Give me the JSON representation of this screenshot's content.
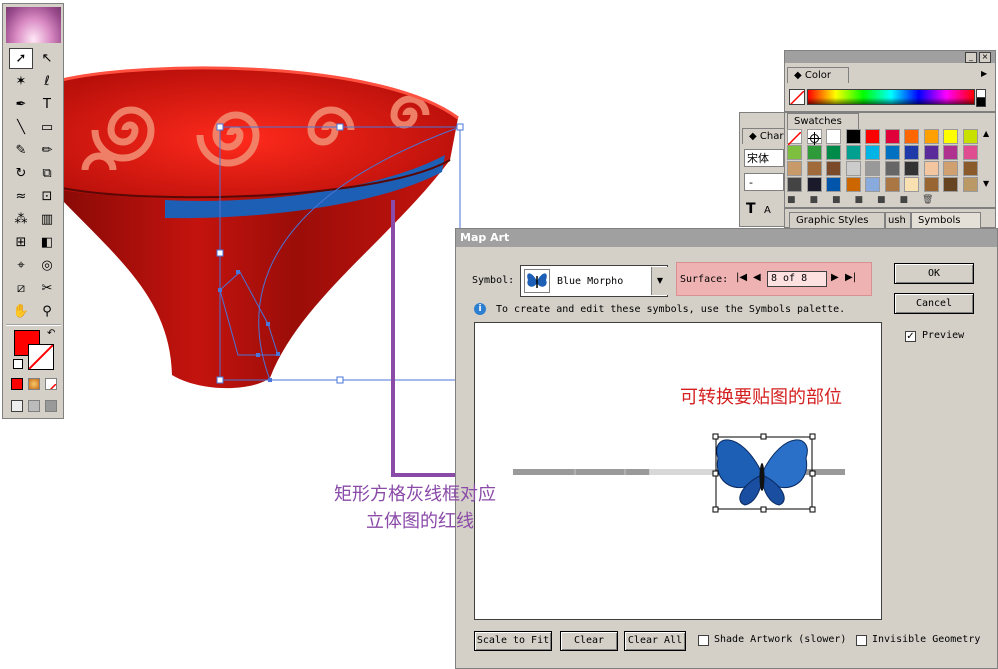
{
  "colors": {
    "vase_red": "#c4130e",
    "swirl": "#f28a70",
    "rim_blue": "#1d5fb5",
    "selection_blue": "#4a74d6",
    "annotation_purple": "#8a4aa8",
    "annotation_pink": "#f5b0b0",
    "annotation_red_text": "#d42020",
    "dialog_bg": "#d4d0c8",
    "fill_swatch": "#ff0000"
  },
  "toolbox": {
    "tools": [
      {
        "name": "selection-tool",
        "glyph": "➚",
        "selected": true
      },
      {
        "name": "direct-selection-tool",
        "glyph": "↖"
      },
      {
        "name": "magic-wand-tool",
        "glyph": "✶"
      },
      {
        "name": "lasso-tool",
        "glyph": "ℓ"
      },
      {
        "name": "pen-tool",
        "glyph": "✒"
      },
      {
        "name": "type-tool",
        "glyph": "T"
      },
      {
        "name": "line-tool",
        "glyph": "╲"
      },
      {
        "name": "rectangle-tool",
        "glyph": "▭"
      },
      {
        "name": "paintbrush-tool",
        "glyph": "✎"
      },
      {
        "name": "pencil-tool",
        "glyph": "✏"
      },
      {
        "name": "rotate-tool",
        "glyph": "↻"
      },
      {
        "name": "scale-tool",
        "glyph": "⧉"
      },
      {
        "name": "warp-tool",
        "glyph": "≈"
      },
      {
        "name": "free-transform-tool",
        "glyph": "⊡"
      },
      {
        "name": "symbol-sprayer-tool",
        "glyph": "⁂"
      },
      {
        "name": "column-graph-tool",
        "glyph": "▥"
      },
      {
        "name": "mesh-tool",
        "glyph": "⊞"
      },
      {
        "name": "gradient-tool",
        "glyph": "◧"
      },
      {
        "name": "eyedropper-tool",
        "glyph": "⌖"
      },
      {
        "name": "blend-tool",
        "glyph": "◎"
      },
      {
        "name": "slice-tool",
        "glyph": "⧄"
      },
      {
        "name": "scissors-tool",
        "glyph": "✂"
      },
      {
        "name": "hand-tool",
        "glyph": "✋"
      },
      {
        "name": "zoom-tool",
        "glyph": "⚲"
      }
    ]
  },
  "color_panel": {
    "tab": "Color"
  },
  "swatches_panel": {
    "tab": "Swatches",
    "swatches": [
      "none",
      "reg",
      "#ffffff",
      "#000000",
      "#ff0000",
      "#e0003a",
      "#ff6600",
      "#ffa000",
      "#ffff00",
      "#c8e000",
      "#7fbf3f",
      "#2f9a3a",
      "#008a4a",
      "#00a090",
      "#00b4e6",
      "#0070c0",
      "#1f3aa8",
      "#5a2a9a",
      "#b03090",
      "#e04c90",
      "#c89a6a",
      "#a06a3a",
      "#7a4a2a",
      "#cccccc",
      "#999999",
      "#666666",
      "#333333",
      "#f4c6a0",
      "#d0a070",
      "#8a5a2a",
      "#444444",
      "#1a1a2a",
      "#0055aa",
      "#cc6600",
      "#88aadd",
      "#aa7744",
      "#f8e0b0",
      "#996633",
      "#664422",
      "#bb9966"
    ]
  },
  "character_panel": {
    "tab": "Char",
    "font": "宋体",
    "size": "-"
  },
  "symbols_panel": {
    "tabs": [
      "Graphic Styles",
      "ush",
      "Symbols"
    ]
  },
  "dialog": {
    "title": "Map Art",
    "symbol_label": "Symbol:",
    "symbol_value": "Blue Morpho",
    "surface_label": "Surface:",
    "surface_value": "8 of 8",
    "info_text": "To create and edit these symbols, use the Symbols palette.",
    "ok": "OK",
    "cancel": "Cancel",
    "preview_label": "Preview",
    "preview_checked": true,
    "scale_to_fit": "Scale to Fit",
    "clear": "Clear",
    "clear_all": "Clear All",
    "shade_label": "Shade Artwork (slower)",
    "invisible_label": "Invisible Geometry"
  },
  "annotations": {
    "surface_note": "可转换要贴图的部位",
    "rect_note_line1": "矩形方格灰线框对应",
    "rect_note_line2": "立体图的红线"
  }
}
